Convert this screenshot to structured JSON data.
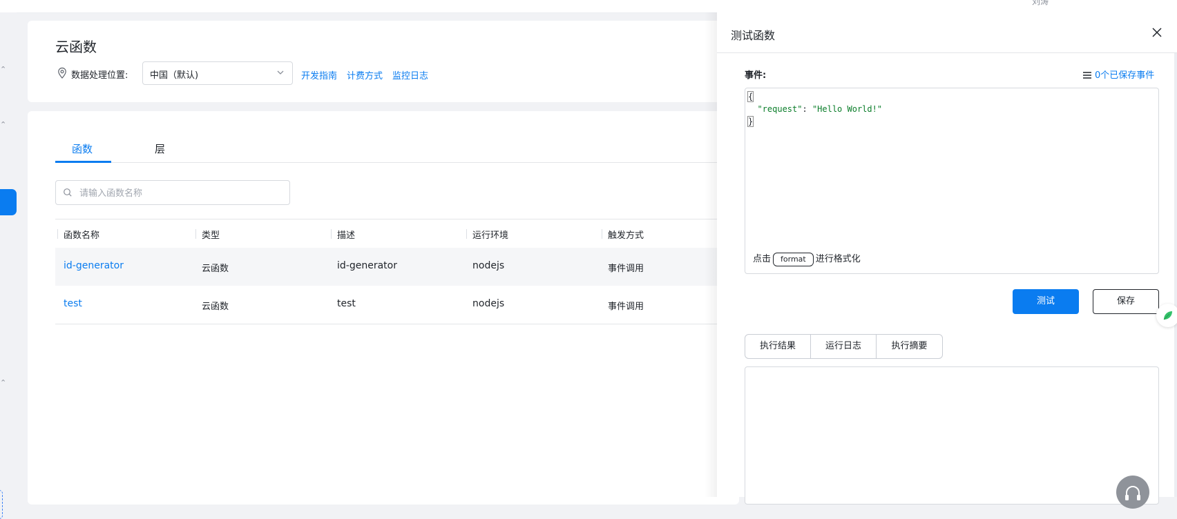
{
  "topbar": {
    "user_name": "刘涛"
  },
  "header": {
    "title": "云函数",
    "location_label": "数据处理位置:",
    "region_select": {
      "value": "中国（默认)"
    },
    "links": [
      "开发指南",
      "计费方式",
      "监控日志"
    ]
  },
  "tabs": [
    {
      "label": "函数",
      "active": true
    },
    {
      "label": "层",
      "active": false
    }
  ],
  "search": {
    "placeholder": "请输入函数名称",
    "value": ""
  },
  "table": {
    "columns": [
      "函数名称",
      "类型",
      "描述",
      "运行环境",
      "触发方式"
    ],
    "rows": [
      {
        "name": "id-generator",
        "type": "云函数",
        "description": "id-generator",
        "runtime": "nodejs",
        "trigger": "事件调用"
      },
      {
        "name": "test",
        "type": "云函数",
        "description": "test",
        "runtime": "nodejs",
        "trigger": "事件调用"
      }
    ]
  },
  "drawer": {
    "title": "测试函数",
    "event_label": "事件:",
    "saved_events_link": "0个已保存事件",
    "editor": {
      "open_brace": "{",
      "key": "\"request\"",
      "colon": ": ",
      "value": "\"Hello World!\"",
      "close_brace": "}"
    },
    "format_hint": {
      "prefix": "点击",
      "button": "format",
      "suffix": "进行格式化"
    },
    "test_button": "测试",
    "save_button": "保存",
    "result_tabs": [
      "执行结果",
      "运行日志",
      "执行摘要"
    ]
  },
  "colors": {
    "accent": "#0a7cf0",
    "page_bg": "#f1f2f5",
    "code_green": "#0a7d29",
    "support_button": "#8f939a"
  },
  "icons": {
    "location": "map-pin-icon",
    "region_select": "chevron-down-icon",
    "search": "search-icon",
    "close": "close-icon",
    "saved_events": "list-icon",
    "support": "headset-icon",
    "side_bubble": "leaf-icon"
  }
}
